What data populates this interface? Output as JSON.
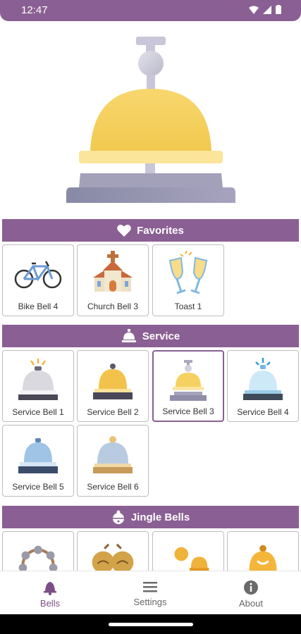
{
  "status_bar": {
    "time": "12:47"
  },
  "sections": [
    {
      "title": "Favorites",
      "icon": "heart-icon",
      "items": [
        {
          "label": "Bike Bell 4",
          "icon": "bicycle-icon"
        },
        {
          "label": "Church Bell 3",
          "icon": "church-icon"
        },
        {
          "label": "Toast 1",
          "icon": "champagne-glasses-icon"
        }
      ]
    },
    {
      "title": "Service",
      "icon": "service-bell-icon",
      "items": [
        {
          "label": "Service Bell 1",
          "icon": "service-bell-gray-icon"
        },
        {
          "label": "Service Bell 2",
          "icon": "service-bell-gold-icon"
        },
        {
          "label": "Service Bell 3",
          "icon": "service-bell-yellow-icon",
          "selected": true
        },
        {
          "label": "Service Bell 4",
          "icon": "service-bell-glass-icon"
        },
        {
          "label": "Service Bell 5",
          "icon": "service-bell-blue-icon"
        },
        {
          "label": "Service Bell 6",
          "icon": "service-bell-dome-icon"
        }
      ]
    },
    {
      "title": "Jingle Bells",
      "icon": "jingle-bell-icon",
      "items": [
        {
          "label": "",
          "icon": "tambourine-icon"
        },
        {
          "label": "",
          "icon": "sleigh-bells-icon"
        },
        {
          "label": "",
          "icon": "jingle-bells-gold-icon"
        },
        {
          "label": "",
          "icon": "jingle-bell-gold-icon"
        }
      ]
    }
  ],
  "bottom_nav": [
    {
      "label": "Bells",
      "icon": "bell-icon",
      "active": true
    },
    {
      "label": "Settings",
      "icon": "menu-icon"
    },
    {
      "label": "About",
      "icon": "info-icon"
    }
  ],
  "colors": {
    "primary": "#8a5f93",
    "bell_gold": "#f7d36a",
    "bell_base": "#8e8ca6"
  }
}
